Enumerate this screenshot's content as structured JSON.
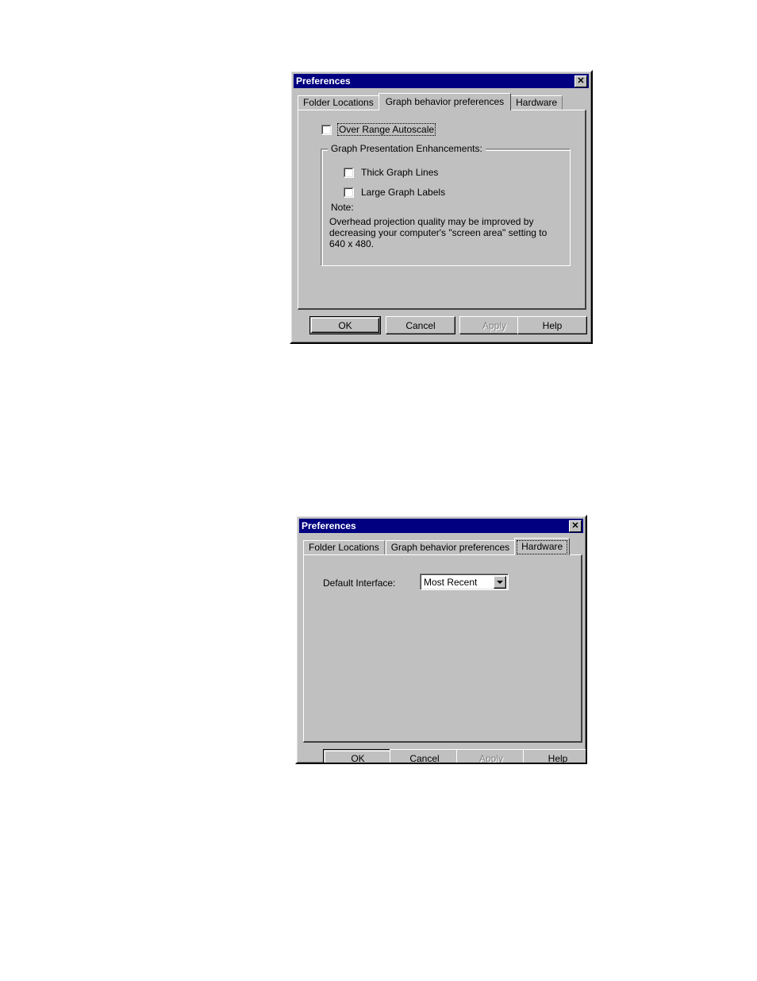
{
  "page": {
    "background": "#ffffff",
    "dialog_face": "#c0c0c0",
    "titlebar_color": "#000080",
    "titlebar_text_color": "#ffffff"
  },
  "dialog1": {
    "title": "Preferences",
    "close_icon": "close-icon",
    "tabs": [
      {
        "label": "Folder Locations",
        "selected": false
      },
      {
        "label": "Graph behavior preferences",
        "selected": true
      },
      {
        "label": "Hardware",
        "selected": false
      }
    ],
    "over_range_autoscale": {
      "label": "Over Range Autoscale",
      "checked": false,
      "focused": true
    },
    "groupbox": {
      "title": "Graph Presentation Enhancements:",
      "checkboxes": [
        {
          "label": "Thick Graph Lines",
          "checked": false
        },
        {
          "label": "Large Graph Labels",
          "checked": false
        }
      ],
      "note_label": "Note:",
      "note_lines": [
        "Overhead projection quality may be improved by",
        "decreasing your computer's \"screen area\" setting to",
        "640 x 480."
      ]
    },
    "buttons": [
      {
        "label": "OK",
        "default": true,
        "disabled": false
      },
      {
        "label": "Cancel",
        "default": false,
        "disabled": false
      },
      {
        "label": "Apply",
        "default": false,
        "disabled": true
      },
      {
        "label": "Help",
        "default": false,
        "disabled": false
      }
    ]
  },
  "dialog2": {
    "title": "Preferences",
    "close_icon": "close-icon",
    "tabs": [
      {
        "label": "Folder Locations",
        "selected": false
      },
      {
        "label": "Graph behavior preferences",
        "selected": false
      },
      {
        "label": "Hardware",
        "selected": true
      }
    ],
    "default_interface": {
      "label": "Default Interface:",
      "value": "Most Recent",
      "arrow_icon": "chevron-down-icon"
    },
    "buttons": [
      {
        "label": "OK",
        "default": true,
        "disabled": false
      },
      {
        "label": "Cancel",
        "default": false,
        "disabled": false
      },
      {
        "label": "Apply",
        "default": false,
        "disabled": true
      },
      {
        "label": "Help",
        "default": false,
        "disabled": false
      }
    ]
  }
}
